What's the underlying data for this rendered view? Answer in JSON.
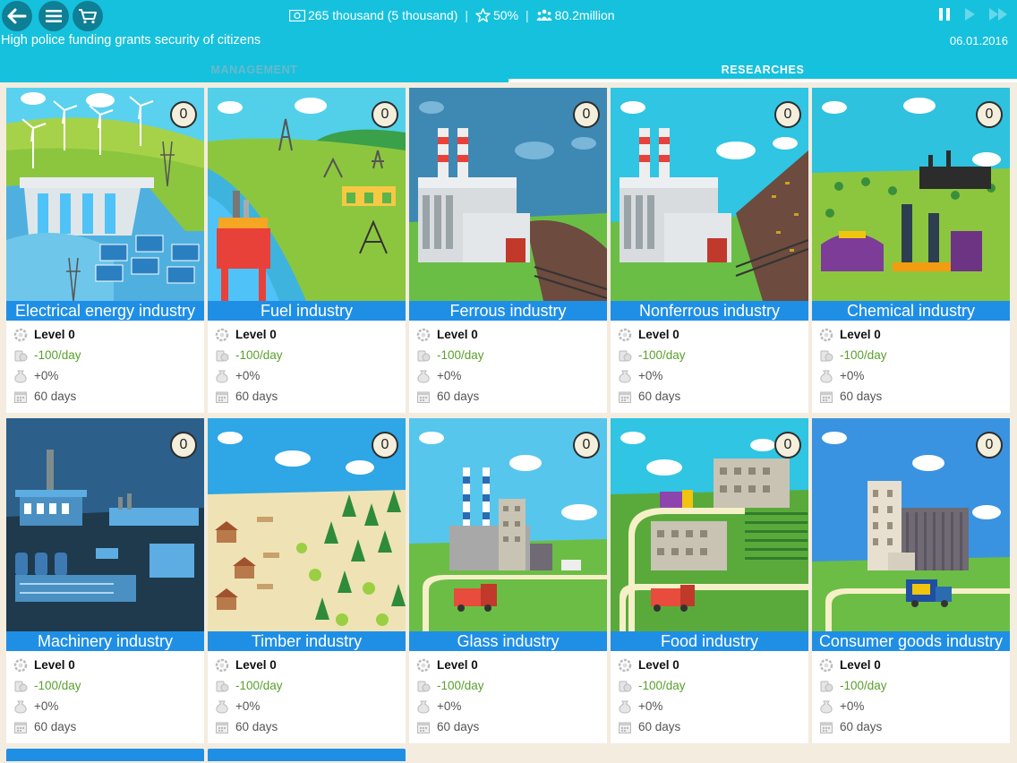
{
  "header": {
    "money": "265 thousand (5 thousand)",
    "rating": "50%",
    "population": "80.2million",
    "message": "High police funding grants security of citizens",
    "date": "06.01.2016",
    "tabs": {
      "management": "MANAGEMENT",
      "researches": "RESEARCHES"
    }
  },
  "cards": [
    {
      "title": "Electrical energy industry",
      "count": "0",
      "level": "Level 0",
      "cost": "-100/day",
      "bonus": "+0%",
      "duration": "60 days",
      "theme": "energy"
    },
    {
      "title": "Fuel industry",
      "count": "0",
      "level": "Level 0",
      "cost": "-100/day",
      "bonus": "+0%",
      "duration": "60 days",
      "theme": "fuel"
    },
    {
      "title": "Ferrous industry",
      "count": "0",
      "level": "Level 0",
      "cost": "-100/day",
      "bonus": "+0%",
      "duration": "60 days",
      "theme": "ferrous"
    },
    {
      "title": "Nonferrous industry",
      "count": "0",
      "level": "Level 0",
      "cost": "-100/day",
      "bonus": "+0%",
      "duration": "60 days",
      "theme": "nonferrous"
    },
    {
      "title": "Chemical industry",
      "count": "0",
      "level": "Level 0",
      "cost": "-100/day",
      "bonus": "+0%",
      "duration": "60 days",
      "theme": "chemical"
    },
    {
      "title": "Machinery industry",
      "count": "0",
      "level": "Level 0",
      "cost": "-100/day",
      "bonus": "+0%",
      "duration": "60 days",
      "theme": "machinery"
    },
    {
      "title": "Timber industry",
      "count": "0",
      "level": "Level 0",
      "cost": "-100/day",
      "bonus": "+0%",
      "duration": "60 days",
      "theme": "timber"
    },
    {
      "title": "Glass industry",
      "count": "0",
      "level": "Level 0",
      "cost": "-100/day",
      "bonus": "+0%",
      "duration": "60 days",
      "theme": "glass"
    },
    {
      "title": "Food industry",
      "count": "0",
      "level": "Level 0",
      "cost": "-100/day",
      "bonus": "+0%",
      "duration": "60 days",
      "theme": "food"
    },
    {
      "title": "Consumer goods industry",
      "count": "0",
      "level": "Level 0",
      "cost": "-100/day",
      "bonus": "+0%",
      "duration": "60 days",
      "theme": "consumer"
    }
  ],
  "colors": {
    "header_bg": "#16c1dd",
    "button_bg": "#0f7f95",
    "title_bar": "#1f8fe6",
    "cost_text": "#5aa02c",
    "page_bg": "#f3ecdf"
  },
  "icons": {
    "back": "back-arrow-icon",
    "menu": "menu-icon",
    "shop": "cart-icon",
    "money": "banknote-icon",
    "rating": "star-icon",
    "population": "people-icon",
    "pause": "pause-icon",
    "play": "play-icon",
    "fast": "fast-forward-icon",
    "level": "gear-icon",
    "cost": "coins-icon",
    "bonus": "money-bag-icon",
    "duration": "calendar-icon"
  }
}
